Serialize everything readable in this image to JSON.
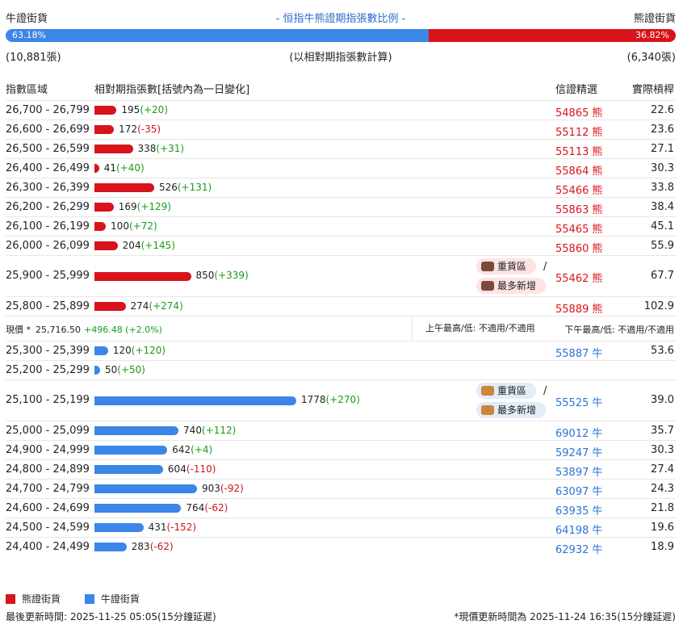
{
  "header": {
    "bull_label": "牛證街貨",
    "title": "- 恒指牛熊證期指張數比例 -",
    "bear_label": "熊證街貨",
    "bull_pct": "63.18%",
    "bear_pct": "36.82%",
    "bull_fraction": 0.6318,
    "bull_count": "(10,881張)",
    "note": "(以相對期指張數計算)",
    "bear_count": "(6,340張)"
  },
  "columns": {
    "range": "指數區域",
    "contracts": "相對期指張數[括號內為一日變化]",
    "featured": "信證精選",
    "leverage": "實際槓桿"
  },
  "bear_rows": [
    {
      "range": "26,700 - 26,799",
      "value": 195,
      "qty": "195",
      "chg": "(+20)",
      "code": "54865",
      "side": "熊",
      "lev": "22.6"
    },
    {
      "range": "26,600 - 26,699",
      "value": 172,
      "qty": "172",
      "chg": "(-35)",
      "code": "55112",
      "side": "熊",
      "lev": "23.6"
    },
    {
      "range": "26,500 - 26,599",
      "value": 338,
      "qty": "338",
      "chg": "(+31)",
      "code": "55113",
      "side": "熊",
      "lev": "27.1"
    },
    {
      "range": "26,400 - 26,499",
      "value": 41,
      "qty": "41",
      "chg": "(+40)",
      "code": "55864",
      "side": "熊",
      "lev": "30.3"
    },
    {
      "range": "26,300 - 26,399",
      "value": 526,
      "qty": "526",
      "chg": "(+131)",
      "code": "55466",
      "side": "熊",
      "lev": "33.8"
    },
    {
      "range": "26,200 - 26,299",
      "value": 169,
      "qty": "169",
      "chg": "(+129)",
      "code": "55863",
      "side": "熊",
      "lev": "38.4"
    },
    {
      "range": "26,100 - 26,199",
      "value": 100,
      "qty": "100",
      "chg": "(+72)",
      "code": "55465",
      "side": "熊",
      "lev": "45.1"
    },
    {
      "range": "26,000 - 26,099",
      "value": 204,
      "qty": "204",
      "chg": "(+145)",
      "code": "55860",
      "side": "熊",
      "lev": "55.9"
    },
    {
      "range": "25,900 - 25,999",
      "value": 850,
      "qty": "850",
      "chg": "(+339)",
      "code": "55462",
      "side": "熊",
      "lev": "67.7",
      "badges": [
        "重貨區",
        "最多新增"
      ]
    },
    {
      "range": "25,800 - 25,899",
      "value": 274,
      "qty": "274",
      "chg": "(+274)",
      "code": "55889",
      "side": "熊",
      "lev": "102.9"
    }
  ],
  "price": {
    "label": "現價 *",
    "value": "25,716.50",
    "change": "+496.48 (+2.0%)",
    "am": "上午最高/低: 不適用/不適用",
    "pm": "下午最高/低: 不適用/不適用"
  },
  "bull_rows": [
    {
      "range": "25,300 - 25,399",
      "value": 120,
      "qty": "120",
      "chg": "(+120)",
      "code": "55887",
      "side": "牛",
      "lev": "53.6"
    },
    {
      "range": "25,200 - 25,299",
      "value": 50,
      "qty": "50",
      "chg": "(+50)",
      "code": "",
      "side": "",
      "lev": ""
    },
    {
      "range": "25,100 - 25,199",
      "value": 1778,
      "qty": "1778",
      "chg": "(+270)",
      "code": "55525",
      "side": "牛",
      "lev": "39.0",
      "badges": [
        "重貨區",
        "最多新增"
      ]
    },
    {
      "range": "25,000 - 25,099",
      "value": 740,
      "qty": "740",
      "chg": "(+112)",
      "code": "69012",
      "side": "牛",
      "lev": "35.7"
    },
    {
      "range": "24,900 - 24,999",
      "value": 642,
      "qty": "642",
      "chg": "(+4)",
      "code": "59247",
      "side": "牛",
      "lev": "30.3"
    },
    {
      "range": "24,800 - 24,899",
      "value": 604,
      "qty": "604",
      "chg": "(-110)",
      "code": "53897",
      "side": "牛",
      "lev": "27.4"
    },
    {
      "range": "24,700 - 24,799",
      "value": 903,
      "qty": "903",
      "chg": "(-92)",
      "code": "63097",
      "side": "牛",
      "lev": "24.3"
    },
    {
      "range": "24,600 - 24,699",
      "value": 764,
      "qty": "764",
      "chg": "(-62)",
      "code": "63935",
      "side": "牛",
      "lev": "21.8"
    },
    {
      "range": "24,500 - 24,599",
      "value": 431,
      "qty": "431",
      "chg": "(-152)",
      "code": "64198",
      "side": "牛",
      "lev": "19.6"
    },
    {
      "range": "24,400 - 24,499",
      "value": 283,
      "qty": "283",
      "chg": "(-62)",
      "code": "62932",
      "side": "牛",
      "lev": "18.9"
    }
  ],
  "legend": {
    "bear": "熊證街貨",
    "bull": "牛證街貨"
  },
  "footer": {
    "updated": "最後更新時間: 2025-11-25 05:05(15分鐘延遲)",
    "price_updated": "*現價更新時間為 2025-11-24 16:35(15分鐘延遲)"
  },
  "colors": {
    "bear": "#d9131b",
    "bull": "#3b86e8",
    "positive": "#1a9a1a",
    "negative": "#c81818"
  },
  "icons": {
    "bear_badge": "bear-icon",
    "bull_badge": "bull-icon"
  }
}
